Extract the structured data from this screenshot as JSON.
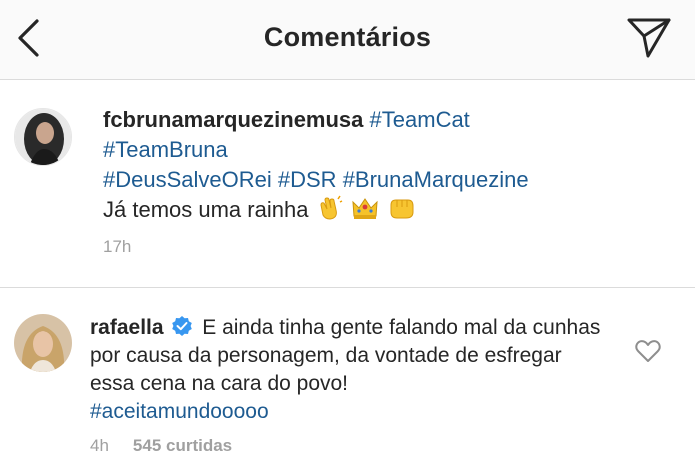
{
  "header": {
    "title": "Comentários",
    "back_icon": "chevron-left-icon",
    "share_icon": "paper-plane-icon"
  },
  "caption": {
    "username": "fcbrunamarquezinemusa",
    "hashtags_line1": "#TeamCat",
    "hashtags_line2": "#TeamBruna",
    "hashtag_1": "#DeusSalveORei",
    "hashtag_2": "#DSR",
    "hashtag_3": "#BrunaMarquezine",
    "text": "Já temos uma rainha",
    "emojis": [
      "clapping-hands-emoji",
      "crown-emoji",
      "fist-emoji"
    ],
    "time": "17h"
  },
  "comment": {
    "username": "rafaella",
    "verified": true,
    "text": "E ainda tinha gente falando mal da cunhas por causa da personagem, da vontade de esfregar essa cena na cara do povo!",
    "hashtag": "#aceitamundooooo",
    "time": "4h",
    "likes": "545 curtidas",
    "like_icon": "heart-outline-icon"
  },
  "colors": {
    "hashtag": "#1e5b91",
    "verified": "#3897f0",
    "meta_gray": "#a0a0a0",
    "divider": "#dbdbdb"
  }
}
